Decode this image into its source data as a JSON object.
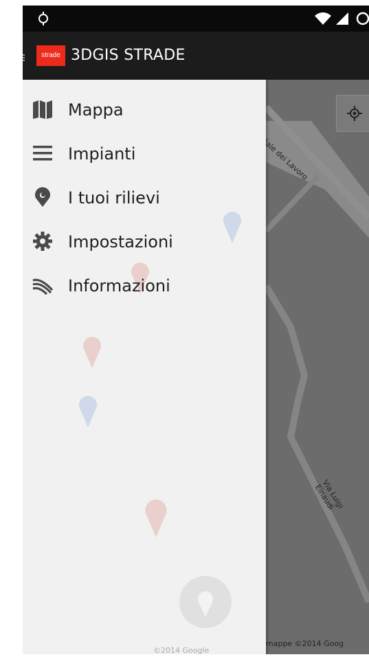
{
  "status_bar": {
    "icons": [
      "location-icon",
      "wifi-icon",
      "signal-icon",
      "clock-icon"
    ]
  },
  "app_bar": {
    "logo_text": "strade",
    "title": "3DGIS STRADE",
    "logo_color": "#ee2a1b"
  },
  "drawer": {
    "items": [
      {
        "label": "Mappa",
        "icon": "map-icon"
      },
      {
        "label": "Impianti",
        "icon": "list-icon"
      },
      {
        "label": "I tuoi rilievi",
        "icon": "pin-icon"
      },
      {
        "label": "Impostazioni",
        "icon": "gear-icon"
      },
      {
        "label": "Informazioni",
        "icon": "waves-icon"
      }
    ],
    "ghost_attribution": "©2014 Google"
  },
  "map": {
    "street_1": "Viale dei Lavoro",
    "street_2": "Via Luigi Einaudi",
    "attribution": "mappe ©2014 Goog",
    "pin_color": "#8b1e22"
  }
}
